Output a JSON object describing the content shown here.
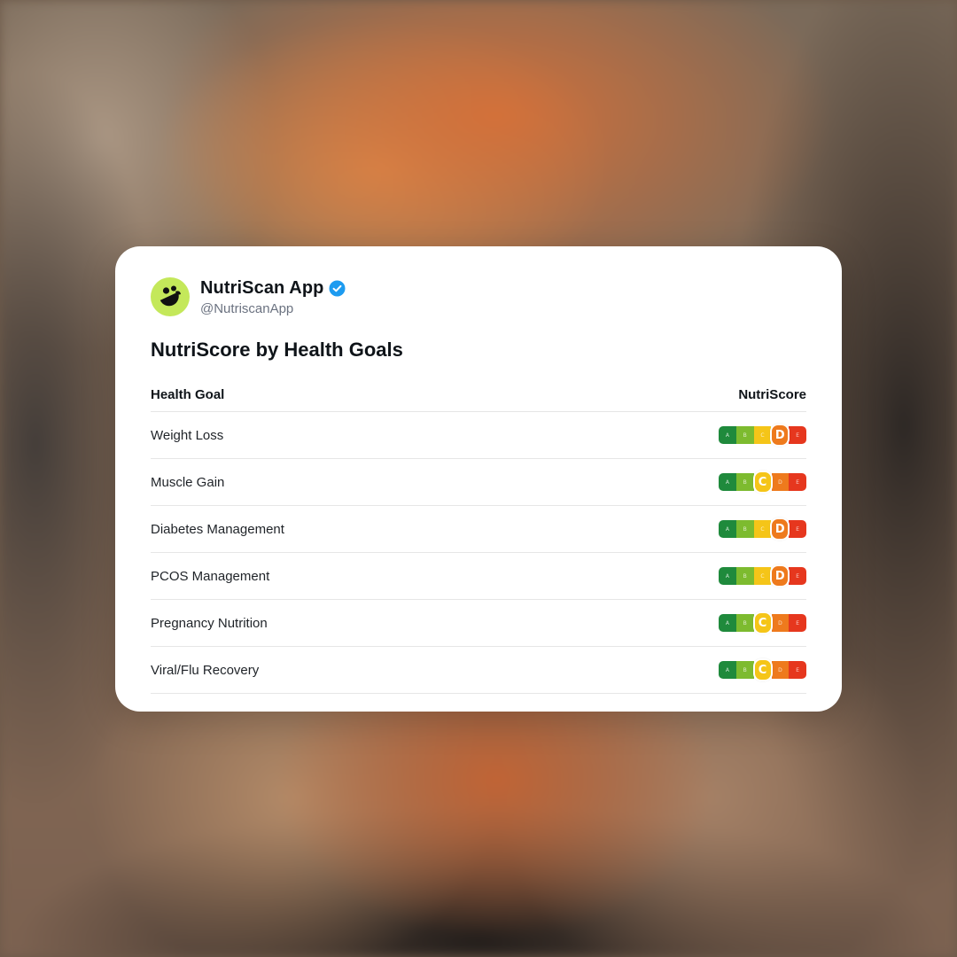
{
  "profile": {
    "app_name": "NutriScan App",
    "handle": "@NutriscanApp",
    "verified": true,
    "avatar_icon": "nutriscan-logo-icon"
  },
  "title": "NutriScore by Health Goals",
  "table": {
    "columns": [
      "Health Goal",
      "NutriScore"
    ],
    "grades": [
      "A",
      "B",
      "C",
      "D",
      "E"
    ],
    "rows": [
      {
        "goal": "Weight Loss",
        "score": "D"
      },
      {
        "goal": "Muscle Gain",
        "score": "C"
      },
      {
        "goal": "Diabetes Management",
        "score": "D"
      },
      {
        "goal": "PCOS Management",
        "score": "D"
      },
      {
        "goal": "Pregnancy Nutrition",
        "score": "C"
      },
      {
        "goal": "Viral/Flu Recovery",
        "score": "C"
      }
    ]
  },
  "colors": {
    "avatar_bg": "#c4e85a",
    "verified_badge": "#1d9bf0",
    "A": "#1f8a3c",
    "B": "#7dbb2f",
    "C": "#f5c518",
    "D": "#ee7a1d",
    "E": "#e6371e"
  }
}
